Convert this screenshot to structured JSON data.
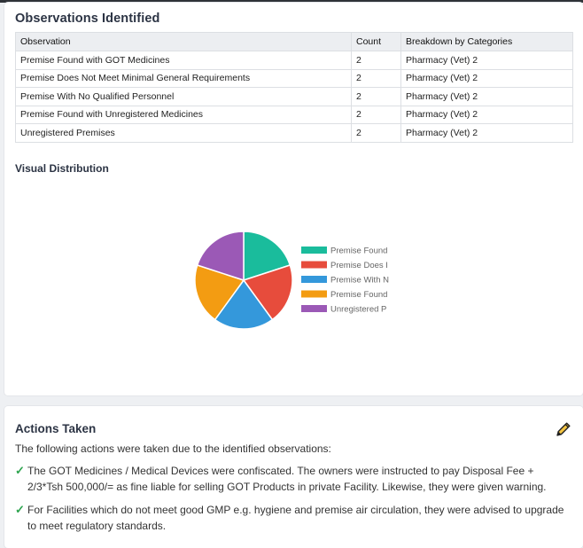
{
  "observations": {
    "title": "Observations Identified",
    "columns": [
      "Observation",
      "Count",
      "Breakdown by Categories"
    ],
    "rows": [
      {
        "observation": "Premise Found with GOT Medicines",
        "count": "2",
        "breakdown": "Pharmacy (Vet) 2"
      },
      {
        "observation": "Premise Does Not Meet Minimal General Requirements",
        "count": "2",
        "breakdown": "Pharmacy (Vet) 2"
      },
      {
        "observation": "Premise With No Qualified Personnel",
        "count": "2",
        "breakdown": "Pharmacy (Vet) 2"
      },
      {
        "observation": "Premise Found with Unregistered Medicines",
        "count": "2",
        "breakdown": "Pharmacy (Vet) 2"
      },
      {
        "observation": "Unregistered Premises",
        "count": "2",
        "breakdown": "Pharmacy (Vet) 2"
      }
    ]
  },
  "visual": {
    "title": "Visual Distribution"
  },
  "chart_data": {
    "type": "pie",
    "categories": [
      "Premise Found with GOT Medicines",
      "Premise Does Not Meet Minimal General Requirements",
      "Premise With No Qualified Personnel",
      "Premise Found with Unregistered Medicines",
      "Unregistered Premises"
    ],
    "legend_labels": [
      "Premise Found",
      "Premise Does I",
      "Premise With N",
      "Premise Found",
      "Unregistered P"
    ],
    "values": [
      2,
      2,
      2,
      2,
      2
    ],
    "colors": [
      "#1abc9c",
      "#e74c3c",
      "#3498db",
      "#f39c12",
      "#9b59b6"
    ],
    "legend_position": "right"
  },
  "actions": {
    "title": "Actions Taken",
    "intro": "The following actions were taken due to the identified observations:",
    "edit_icon": "pencil-icon",
    "check_icon": "check-icon",
    "items": [
      "The GOT Medicines / Medical Devices were confiscated. The owners were instructed to pay Disposal Fee + 2/3*Tsh 500,000/= as fine liable for selling GOT Products in private Facility. Likewise, they were given warning.",
      "For Facilities which do not meet good GMP e.g. hygiene and premise air circulation, they were advised to upgrade to meet regulatory standards."
    ]
  }
}
